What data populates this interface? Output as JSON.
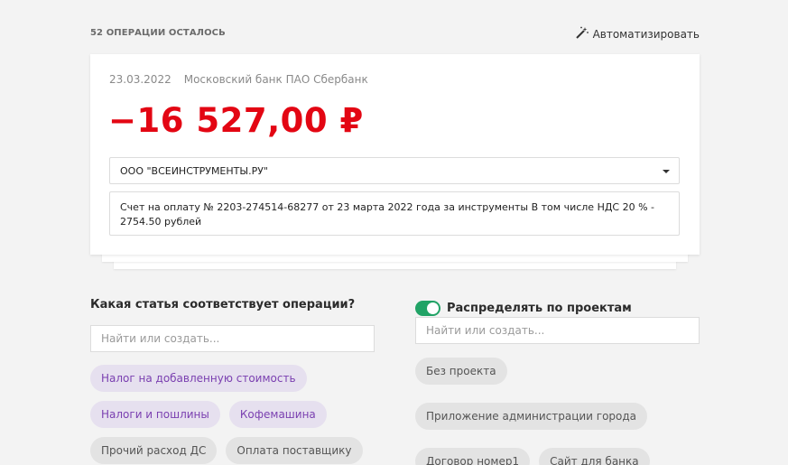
{
  "header": {
    "ops_left": "52 ОПЕРАЦИИ ОСТАЛОСЬ",
    "automate_label": "Автоматизировать"
  },
  "operation": {
    "date": "23.03.2022",
    "bank": "Московский банк ПАО Сбербанк",
    "amount": "−16 527,00 ₽",
    "amount_color": "#e30613",
    "counterparty": "ООО \"ВСЕИНСТРУМЕНТЫ.РУ\"",
    "description": "Счет на оплату № 2203-274514-68277 от 23 марта 2022 года за инструменты В том числе НДС 20 % - 2754.50 рублей"
  },
  "categories": {
    "title": "Какая статья соответствует операции?",
    "search_placeholder": "Найти или создать...",
    "chips": [
      "Налог на добавленную стоимость",
      "Налоги и пошлины",
      "Кофемашина",
      "Прочий расход ДС",
      "Оплата поставщику"
    ]
  },
  "projects": {
    "toggle_label": "Распределять по проектам",
    "toggle_on": true,
    "search_placeholder": "Найти или создать...",
    "chips": [
      "Без проекта",
      "Приложение администрации города",
      "Договор номер1",
      "Сайт для банка"
    ]
  },
  "colors": {
    "accent_green": "#21a366",
    "purple_chip_bg": "#e6e0ef",
    "purple_chip_text": "#7a3fb0"
  },
  "icons": {
    "automate": "magic-wand-icon",
    "dropdown": "caret-down-icon"
  }
}
